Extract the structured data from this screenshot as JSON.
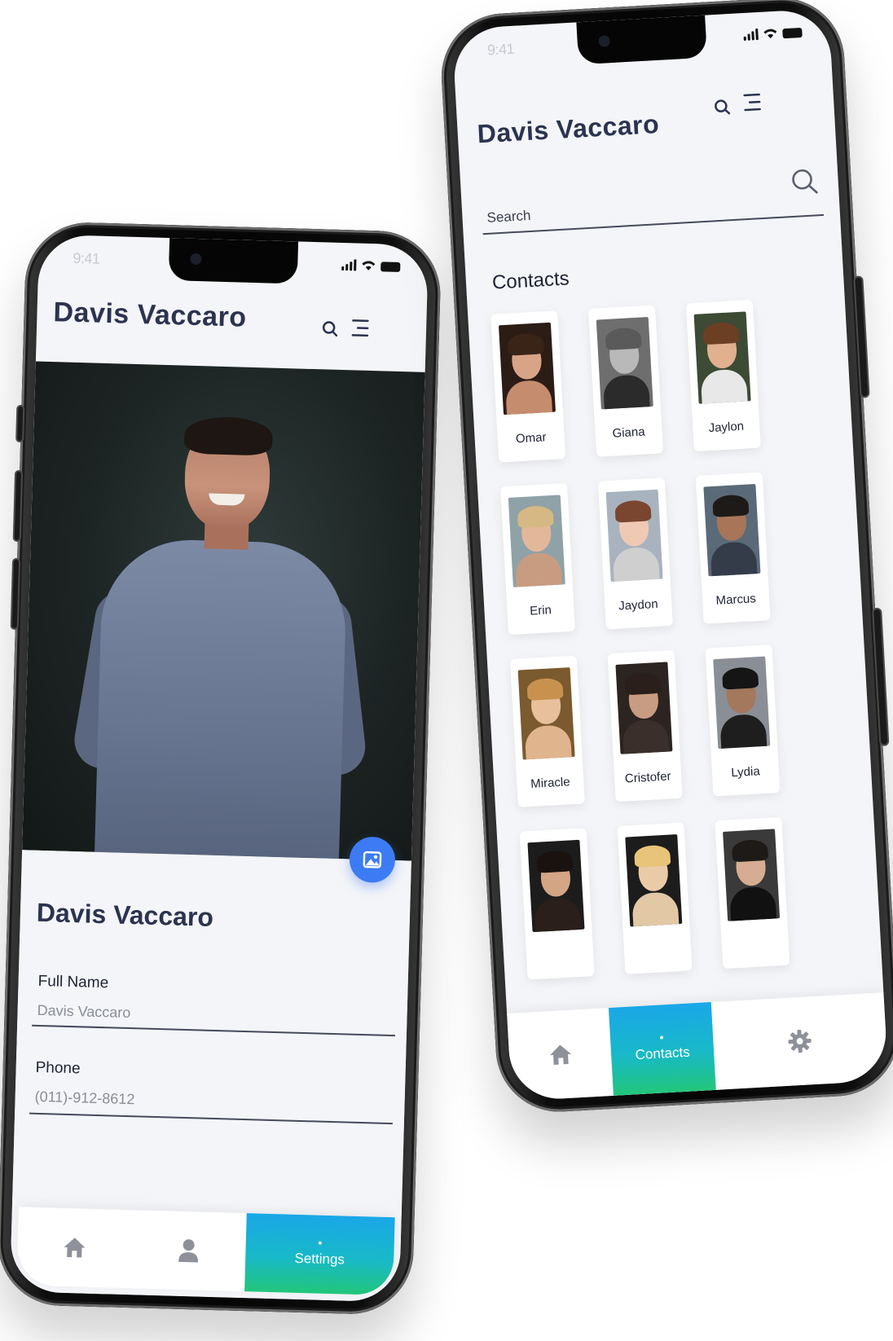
{
  "left_phone": {
    "status_time": "9:41",
    "header_title": "Davis Vaccaro",
    "profile_name": "Davis Vaccaro",
    "fields": [
      {
        "label": "Full Name",
        "value": "Davis Vaccaro"
      },
      {
        "label": "Phone",
        "value": "(011)-912-8612"
      }
    ],
    "tabs": [
      {
        "icon": "home-icon",
        "label": ""
      },
      {
        "icon": "user-icon",
        "label": ""
      },
      {
        "icon": "",
        "label": "Settings",
        "active": true
      }
    ]
  },
  "right_phone": {
    "status_time": "9:41",
    "header_title": "Davis Vaccaro",
    "search": {
      "placeholder": "Search"
    },
    "section_title": "Contacts",
    "contacts": [
      {
        "name": "Omar",
        "skin": "#d8a487",
        "hair": "#3a2418",
        "shirt": "#c68c6e",
        "bg": "#2b1c16"
      },
      {
        "name": "Giana",
        "skin": "#b9b9b9",
        "hair": "#5a5a5a",
        "shirt": "#2b2b2b",
        "bg": "#6e6e6e"
      },
      {
        "name": "Jaylon",
        "skin": "#e0b08f",
        "hair": "#6b3f24",
        "shirt": "#e8e8e8",
        "bg": "#3d4a34"
      },
      {
        "name": "Erin",
        "skin": "#e3b79a",
        "hair": "#d6b884",
        "shirt": "#c89c80",
        "bg": "#8fa2a8"
      },
      {
        "name": "Jaydon",
        "skin": "#efc9b3",
        "hair": "#7a4630",
        "shirt": "#cfcfcf",
        "bg": "#a8b3bf"
      },
      {
        "name": "Marcus",
        "skin": "#a87558",
        "hair": "#1e1a18",
        "shirt": "#343c4a",
        "bg": "#5b6a78"
      },
      {
        "name": "Miracle",
        "skin": "#e8c09c",
        "hair": "#c8914e",
        "shirt": "#e0b48c",
        "bg": "#7a5a2e"
      },
      {
        "name": "Cristofer",
        "skin": "#c89c82",
        "hair": "#2a1f1a",
        "shirt": "#3a2f2a",
        "bg": "#2c2420"
      },
      {
        "name": "Lydia",
        "skin": "#a3785c",
        "hair": "#151515",
        "shirt": "#1e1e1e",
        "bg": "#8a8f96"
      },
      {
        "name": "",
        "skin": "#d3a585",
        "hair": "#1a120e",
        "shirt": "#2a1f1a",
        "bg": "#1c1c1c"
      },
      {
        "name": "",
        "skin": "#eacba8",
        "hair": "#e8c47a",
        "shirt": "#e2c8a4",
        "bg": "#1c1c1c"
      },
      {
        "name": "",
        "skin": "#d6ad92",
        "hair": "#1e1a18",
        "shirt": "#111111",
        "bg": "#3a3a3a"
      }
    ],
    "tabs": [
      {
        "icon": "home-icon",
        "label": ""
      },
      {
        "icon": "",
        "label": "Contacts",
        "active": true
      },
      {
        "icon": "gear-icon",
        "label": ""
      }
    ]
  },
  "colors": {
    "title": "#2b3350",
    "accent_blue": "#3d7bf5",
    "gradient_start": "#1aa7e8",
    "gradient_end": "#22c67a",
    "screen_bg": "#f4f5f8"
  }
}
